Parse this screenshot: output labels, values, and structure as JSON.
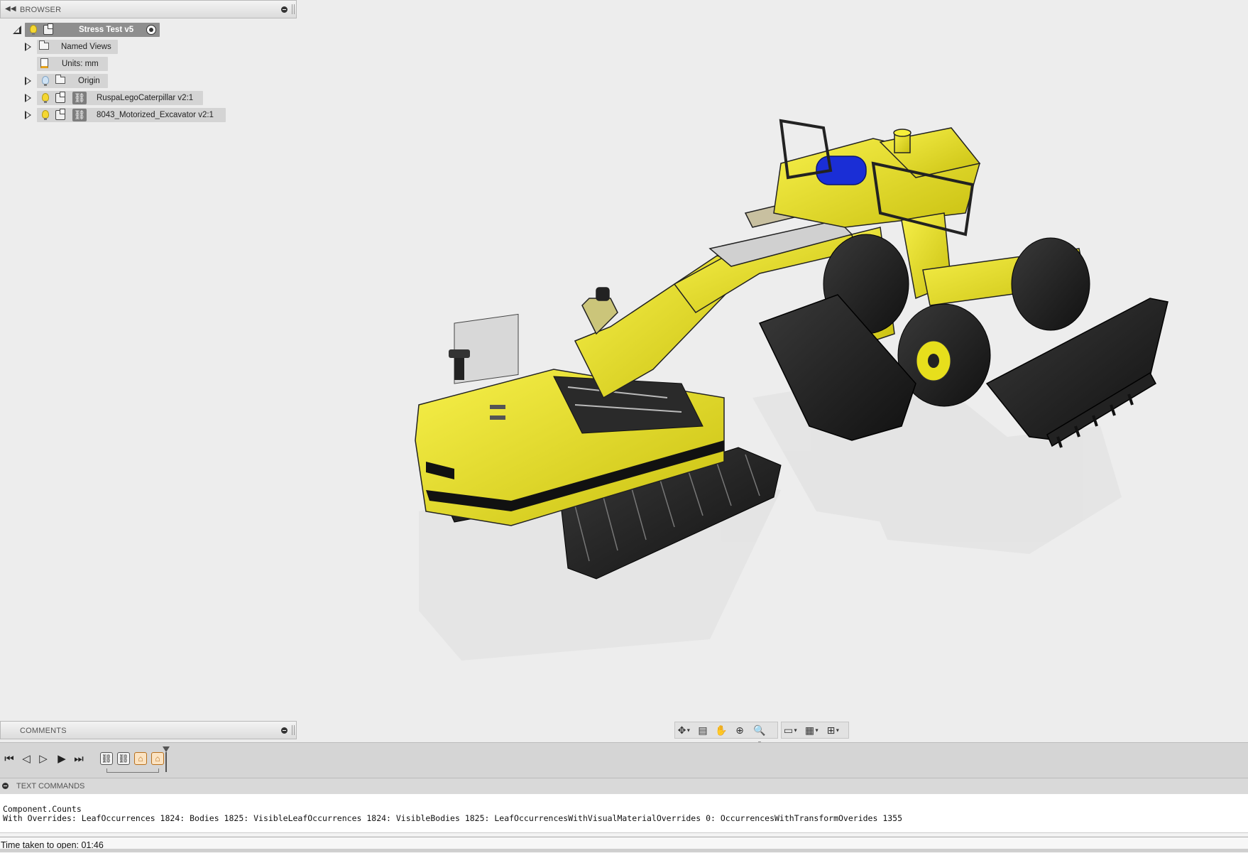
{
  "browser": {
    "header_label": "BROWSER",
    "items": [
      {
        "label": "Stress Test v5",
        "type": "root"
      },
      {
        "label": "Named Views",
        "type": "folder"
      },
      {
        "label": "Units: mm",
        "type": "units"
      },
      {
        "label": "Origin",
        "type": "folder"
      },
      {
        "label": "RuspaLegoCaterpillar v2:1",
        "type": "linked-component"
      },
      {
        "label": "8043_Motorized_Excavator v2:1",
        "type": "linked-component"
      }
    ]
  },
  "comments": {
    "header_label": "COMMENTS"
  },
  "navbar": {
    "icons": [
      "orbit-icon",
      "look-at-icon",
      "pan-icon",
      "zoom-window-icon",
      "zoom-icon",
      "display-settings-icon",
      "grid-icon",
      "viewports-icon"
    ]
  },
  "timeline": {
    "controls": [
      "go-to-start-icon",
      "step-back-icon",
      "play-reverse-icon",
      "play-icon",
      "go-to-end-icon"
    ],
    "features": [
      "link-feature-icon",
      "link-feature-icon",
      "joint-feature-icon",
      "joint-feature-icon"
    ]
  },
  "text_commands": {
    "header_label": "TEXT COMMANDS",
    "lines": [
      "Component.Counts",
      "With Overrides: LeafOccurrences 1824: Bodies 1825: VisibleLeafOccurrences 1824: VisibleBodies 1825: LeafOccurrencesWithVisualMaterialOverrides 0: OccurrencesWithTransformOverides 1355"
    ]
  },
  "status": {
    "text": "Time taken to open: 01:46"
  },
  "colors": {
    "model_yellow": "#f2ea1c",
    "model_dark": "#1e1e1e",
    "model_blue": "#1a2ed6",
    "bulb_on": "#f5d732",
    "bulb_off": "#cfe3f5"
  }
}
